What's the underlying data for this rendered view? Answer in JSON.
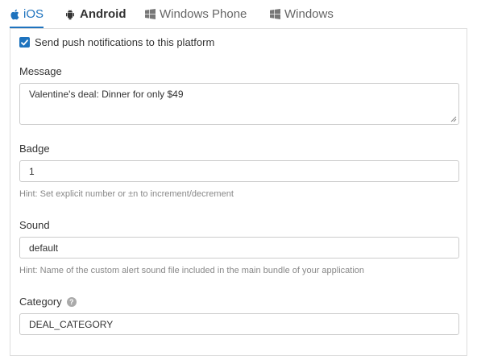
{
  "tabs": [
    {
      "label": "iOS",
      "icon": "apple-icon",
      "active": true
    },
    {
      "label": "Android",
      "icon": "android-icon",
      "active": false
    },
    {
      "label": "Windows Phone",
      "icon": "windows-icon",
      "active": false
    },
    {
      "label": "Windows",
      "icon": "windows-icon",
      "active": false
    }
  ],
  "form": {
    "push_checkbox": {
      "label": "Send push notifications to this platform",
      "checked": true
    },
    "message": {
      "label": "Message",
      "value": "Valentine's deal: Dinner for only $49"
    },
    "badge": {
      "label": "Badge",
      "value": "1",
      "hint": "Hint: Set explicit number or ±n to increment/decrement"
    },
    "sound": {
      "label": "Sound",
      "value": "default",
      "hint": "Hint: Name of the custom alert sound file included in the main bundle of your application"
    },
    "category": {
      "label": "Category",
      "value": "DEAL_CATEGORY",
      "help_icon": "question-circle-icon"
    }
  },
  "colors": {
    "accent": "#1e73be",
    "border": "#dddddd",
    "hint": "#888888"
  }
}
